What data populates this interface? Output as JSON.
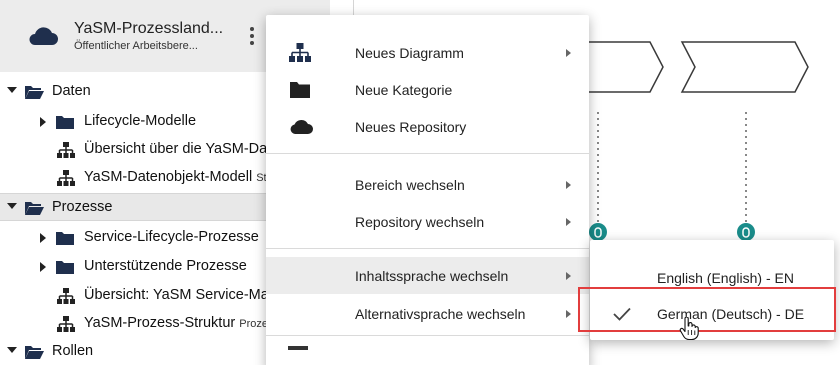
{
  "header": {
    "title": "YaSM-Prozessland...",
    "subtitle": "Öffentlicher Arbeitsbere...",
    "logo_icon": "cloud-icon",
    "menu_icon": "more-vertical-icon"
  },
  "tree": {
    "items": [
      {
        "label": "Daten",
        "type": "folder-open",
        "expanded": true
      },
      {
        "label": "Lifecycle-Modelle",
        "type": "folder",
        "expanded": false
      },
      {
        "label": "Übersicht über die YaSM-Daten",
        "type": "diagram"
      },
      {
        "label": "YaSM-Datenobjekt-Modell",
        "suffix": "Stru",
        "type": "diagram"
      },
      {
        "label": "Prozesse",
        "type": "folder-open",
        "expanded": true,
        "selected": true
      },
      {
        "label": "Service-Lifecycle-Prozesse",
        "type": "folder",
        "expanded": false
      },
      {
        "label": "Unterstützende Prozesse",
        "type": "folder",
        "expanded": false
      },
      {
        "label": "Übersicht: YaSM Service-Mana",
        "type": "diagram"
      },
      {
        "label": "YaSM-Prozess-Struktur",
        "suffix": "Prozes",
        "type": "diagram"
      },
      {
        "label": "Rollen",
        "type": "folder-open",
        "expanded": true
      }
    ]
  },
  "context_menu": {
    "items": [
      {
        "label": "Neues Diagramm",
        "icon": "diagram-icon",
        "submenu": true
      },
      {
        "label": "Neue Kategorie",
        "icon": "folder-icon",
        "submenu": false
      },
      {
        "label": "Neues Repository",
        "icon": "cloud-icon",
        "submenu": false
      },
      {
        "label": "Bereich wechseln",
        "submenu": true
      },
      {
        "label": "Repository wechseln",
        "submenu": true
      },
      {
        "label": "Inhaltssprache wechseln",
        "submenu": true,
        "highlighted": true
      },
      {
        "label": "Alternativsprache wechseln",
        "submenu": true
      }
    ]
  },
  "language_submenu": {
    "items": [
      {
        "label": "English (English) - EN",
        "checked": false
      },
      {
        "label": "German (Deutsch) - DE",
        "checked": true
      }
    ]
  },
  "colors": {
    "folder": "#1f2f4d",
    "diagram_shape_border": "#3a3a3a",
    "connector_teal": "#1a8c8a",
    "highlight_box": "#e23d3d",
    "header_bg": "#ececec"
  }
}
